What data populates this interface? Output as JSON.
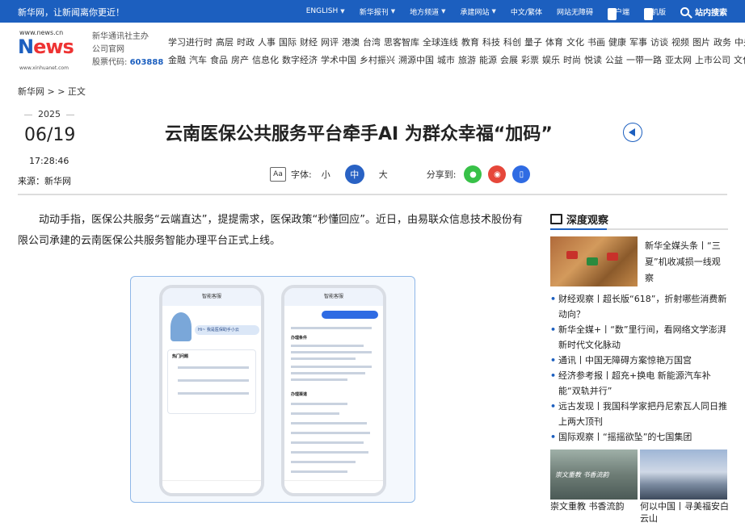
{
  "topbar": {
    "slogan": "新华网，让新闻离你更近！",
    "nav": [
      {
        "label": "ENGLISH",
        "dropdown": true
      },
      {
        "label": "新华报刊",
        "dropdown": true
      },
      {
        "label": "地方频道",
        "dropdown": true
      },
      {
        "label": "承建网站",
        "dropdown": true
      },
      {
        "label": "中文/繁体",
        "dropdown": false
      },
      {
        "label": "网站无障碍",
        "dropdown": false
      }
    ],
    "client": "客户端",
    "mobile": "手机版",
    "search": "站内搜索"
  },
  "logo": {
    "url": "www.news.cn",
    "name": "新华网",
    "sub": "www.xinhuanet.com"
  },
  "org": {
    "line1": "新华通讯社主办",
    "line2": "公司官网",
    "stock_label": "股票代码:",
    "stock_code": "603888"
  },
  "channels": {
    "row1": [
      "学习进行时",
      "高层",
      "时政",
      "人事",
      "国际",
      "财经",
      "网评",
      "港澳",
      "台湾",
      "思客智库",
      "全球连线",
      "教育",
      "科技",
      "科创",
      "量子",
      "体育",
      "文化",
      "书画",
      "健康",
      "军事",
      "访谈",
      "视频",
      "图片",
      "政务",
      "中央文件"
    ],
    "row2": [
      "金融",
      "汽车",
      "食品",
      "房产",
      "信息化",
      "数字经济",
      "学术中国",
      "乡村振兴",
      "溯源中国",
      "城市",
      "旅游",
      "能源",
      "会展",
      "彩票",
      "娱乐",
      "时尚",
      "悦读",
      "公益",
      "一带一路",
      "亚太网",
      "上市公司",
      "文化产业"
    ]
  },
  "breadcrumb": "新华网 > > 正文",
  "date": {
    "year": "2025",
    "monthday": "06/19",
    "time": "17:28:46"
  },
  "source": "来源：新华网",
  "article": {
    "title": "云南医保公共服务平台牵手AI 为群众幸福“加码”",
    "paragraph": "动动手指，医保公共服务“云端直达”，提提需求，医保政策“秒懂回应”。近日，由易联众信息技术股份有限公司承建的云南医保公共服务智能办理平台正式上线。"
  },
  "toolbar": {
    "font_label": "字体:",
    "size_small": "小",
    "size_mid": "中",
    "size_large": "大",
    "share_label": "分享到:"
  },
  "phone_screens": {
    "left": {
      "title": "智能客服",
      "greeting": "Hi~ 我是医保助手小云",
      "section": "热门问题"
    },
    "right": {
      "title": "智能客服",
      "heading1": "办理条件",
      "heading2": "办理渠道"
    }
  },
  "sidebar": {
    "title": "深度观察",
    "top_story": "新华全媒头条丨“三夏”机收减损一线观察",
    "items": [
      "财经观察丨超长版“618”，折射哪些消费新动向？",
      "新华全媒+丨“数”里行间，看网络文学澎湃新时代文化脉动",
      "通讯丨中国无障碍方案惊艳万国宫",
      "经济参考报丨超充+换电 新能源汽车补能“双轨并行”",
      "远古发现丨我国科学家把丹尼索瓦人同日推上两大顶刊",
      "国际观察丨“摇摇欲坠”的七国集团"
    ],
    "pic1_caption": "崇文重教 书香流韵",
    "pic1_overlay": "崇文重教  书香流韵",
    "pic2_caption": "何以中国丨寻美福安白云山"
  }
}
